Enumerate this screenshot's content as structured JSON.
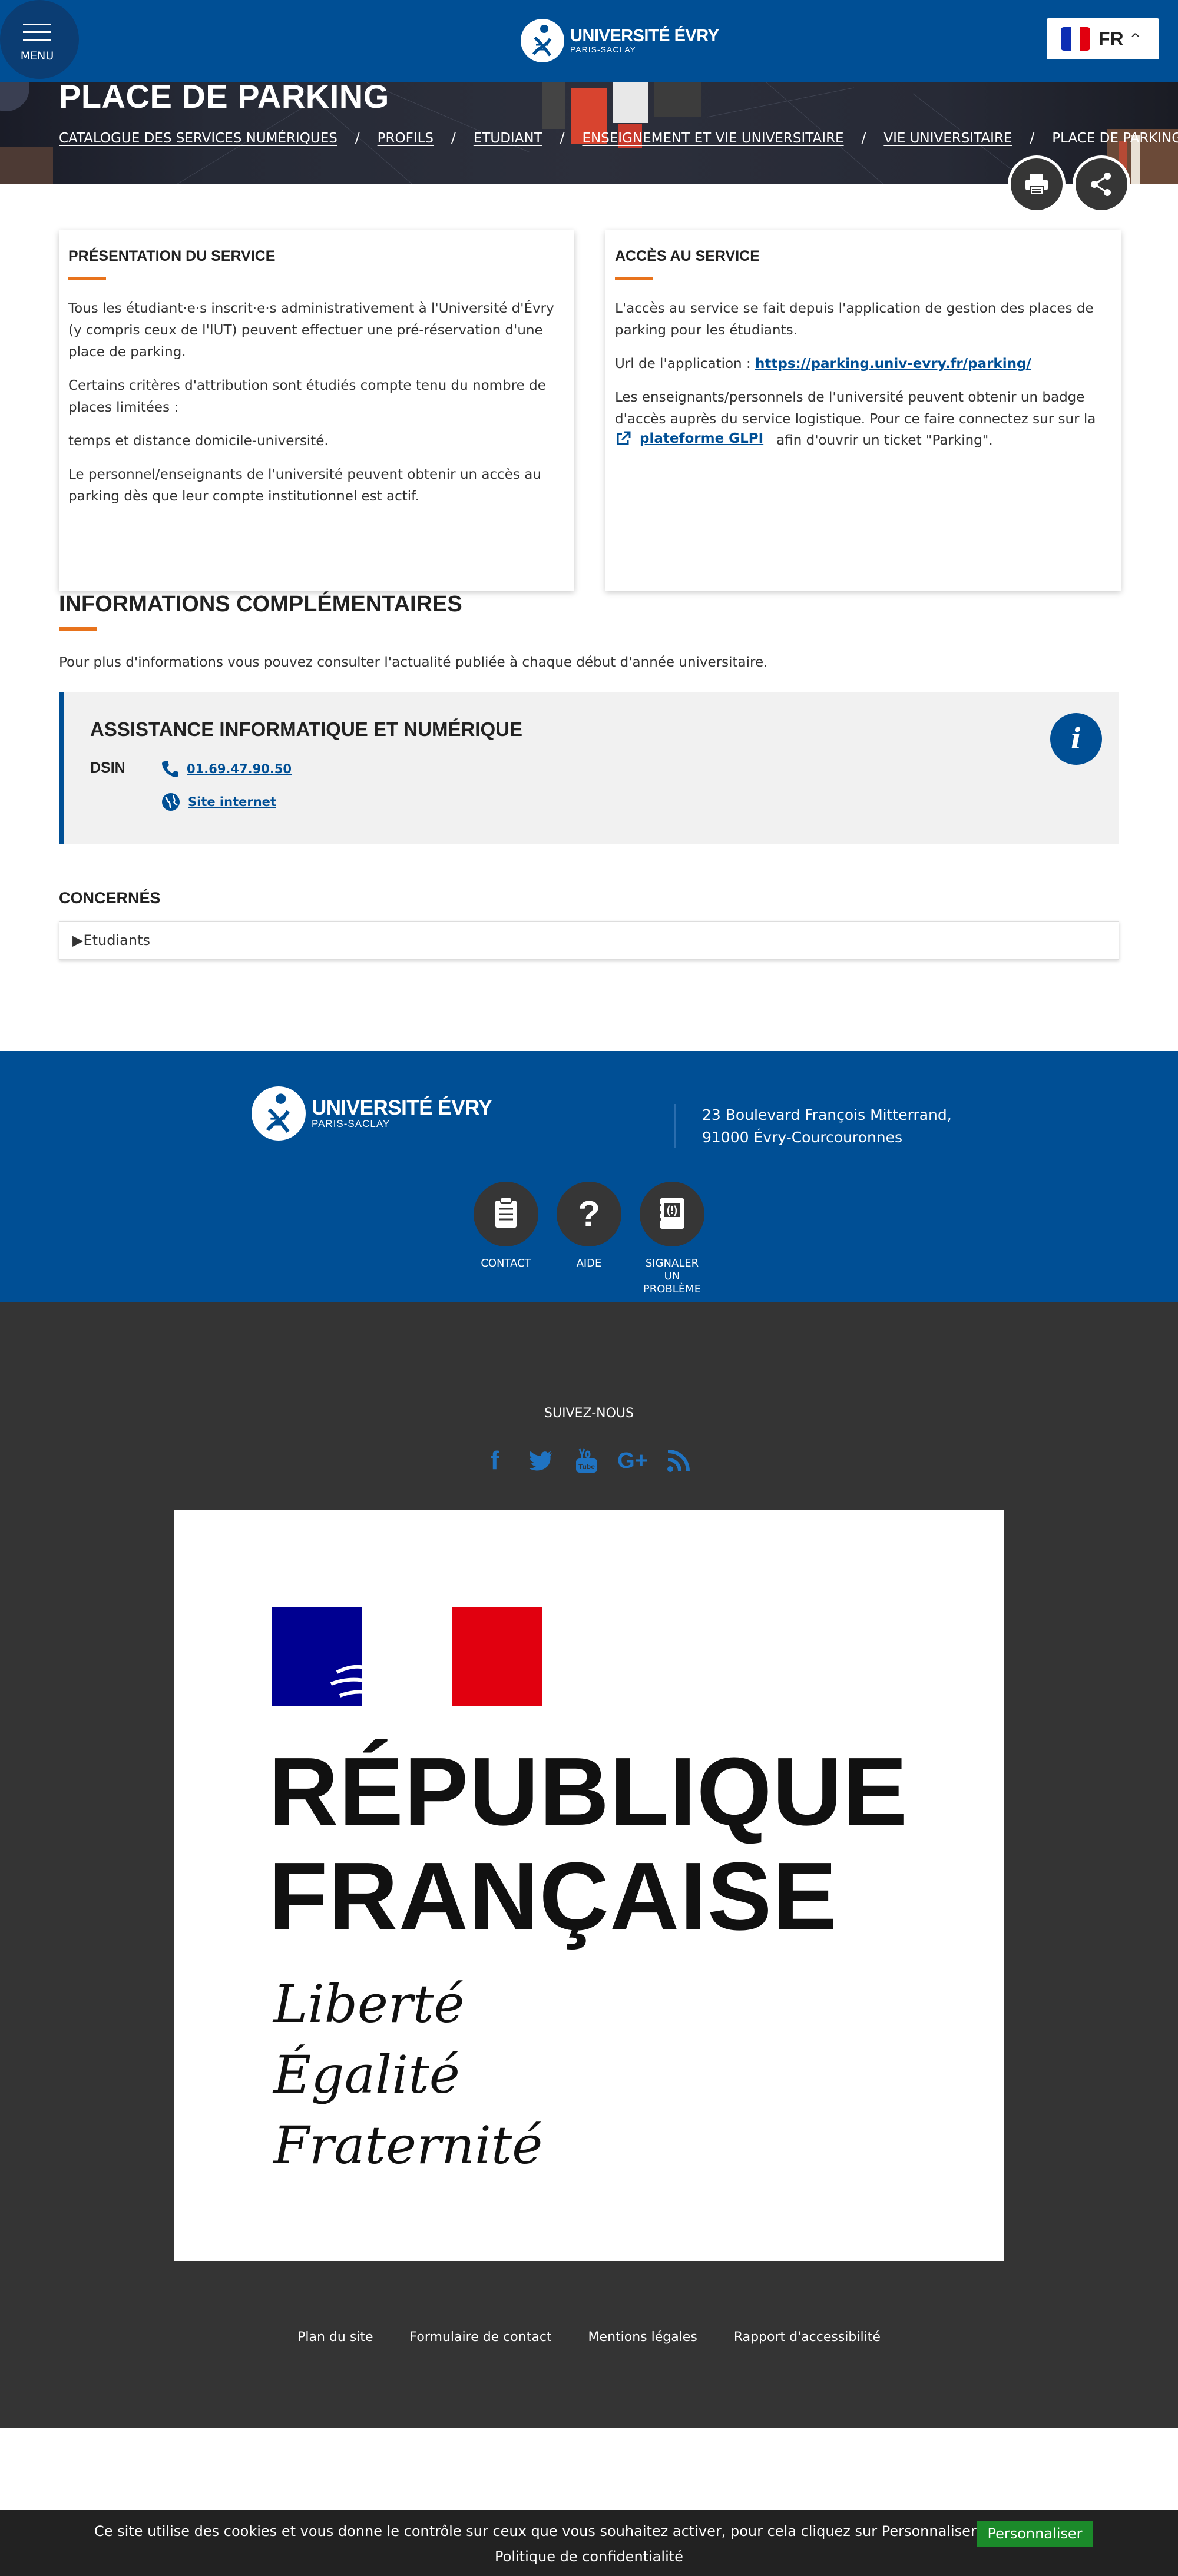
{
  "header": {
    "menu_label": "MENU",
    "logo": {
      "line1": "UNIVERSITÉ ÉVRY",
      "line2": "PARIS-SACLAY"
    },
    "language": "FR",
    "flag_colors": [
      "#0d2eb4",
      "#ffffff",
      "#e1000f"
    ]
  },
  "page": {
    "title": "PLACE DE PARKING",
    "breadcrumbs": [
      "CATALOGUE DES SERVICES NUMÉRIQUES",
      "PROFILS",
      "ETUDIANT",
      "ENSEIGNEMENT ET VIE UNIVERSITAIRE",
      "VIE UNIVERSITAIRE",
      "PLACE DE PARKING"
    ],
    "breadcrumb_sep": "/",
    "actions": [
      "print-icon",
      "share-icon"
    ]
  },
  "presentation": {
    "title": "PRÉSENTATION DU SERVICE",
    "p1": "Tous les étudiant·e·s inscrit·e·s administrativement à l'Université d'Évry (y compris ceux de l'IUT) peuvent effectuer une pré-réservation d'une place de parking.",
    "p2": "Certains critères d'attribution sont étudiés compte tenu du nombre de places limitées :",
    "p3": "temps et distance domicile-université.",
    "p4": "Le personnel/enseignants de l'université peuvent obtenir un accès au parking dès que leur compte institutionnel est actif."
  },
  "access": {
    "title": "ACCÈS AU SERVICE",
    "p1": "L'accès au service se fait depuis l'application de gestion des places de parking pour les étudiants.",
    "url_label": "Url de l'application :",
    "url": "https://parking.univ-evry.fr/parking/",
    "p3": "Les enseignants/personnels de l'université peuvent obtenir un badge d'accès auprès du service logistique. Pour ce faire connectez sur sur la",
    "glpi_link": "plateforme GLPI",
    "glpi_after": "afin d'ouvrir un ticket \"Parking\"."
  },
  "infos": {
    "title": "INFORMATIONS COMPLÉMENTAIRES",
    "text": "Pour plus d'informations vous pouvez consulter l'actualité publiée à chaque début d'année universitaire.",
    "assistance": {
      "title": "ASSISTANCE INFORMATIQUE ET NUMÉRIQUE",
      "org": "DSIN",
      "phone": "01.69.47.90.50",
      "site": "Site internet"
    }
  },
  "concern": {
    "title": "CONCERNÉS",
    "item": "▶Etudiants"
  },
  "footer": {
    "address_line1": "23 Boulevard François Mitterrand,",
    "address_line2": "91000 Évry-Courcouronnes",
    "quick": [
      {
        "label": "CONTACT",
        "icon": "clipboard-icon"
      },
      {
        "label": "AIDE",
        "icon": "question-icon"
      },
      {
        "label_lines": [
          "SIGNALER",
          "UN",
          "PROBLÈME"
        ],
        "icon": "report-phone-icon"
      }
    ],
    "follow": "SUIVEZ-NOUS",
    "social": [
      "facebook-icon",
      "twitter-icon",
      "youtube-icon",
      "googleplus-icon",
      "rss-icon"
    ],
    "social_color": "#1f73c2",
    "republique": {
      "line1": "RÉPUBLIQUE",
      "line2": "FRANÇAISE",
      "motto": [
        "Liberté",
        "Égalité",
        "Fraternité"
      ]
    },
    "links": [
      "Plan du site",
      "Formulaire de contact",
      "Mentions légales",
      "Rapport d'accessibilité"
    ]
  },
  "cookie": {
    "text": "Ce site utilise des cookies et vous donne le contrôle sur ceux que vous souhaitez activer, pour cela cliquez sur Personnaliser",
    "policy": "Politique de confidentialité",
    "button": "Personnaliser"
  },
  "colors": {
    "brand_blue": "#004f95",
    "accent_orange": "#e8731c",
    "dark": "#343434"
  }
}
